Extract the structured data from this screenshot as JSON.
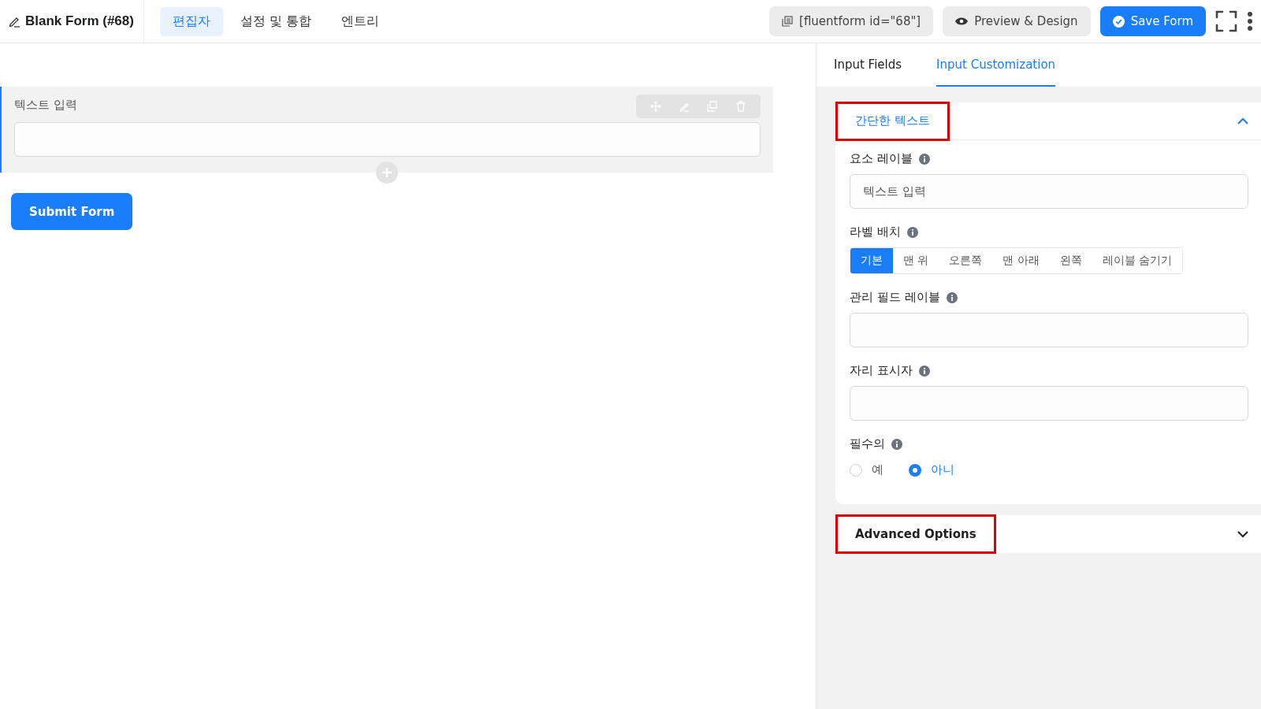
{
  "header": {
    "form_title": "Blank Form (#68)",
    "tabs": [
      {
        "label": "편집자",
        "selected": true
      },
      {
        "label": "설정 및 통합",
        "selected": false
      },
      {
        "label": "엔트리",
        "selected": false
      }
    ],
    "shortcode": "[fluentform id=\"68\"]",
    "preview_button": "Preview & Design",
    "save_button": "Save Form"
  },
  "canvas": {
    "field": {
      "label": "텍스트 입력"
    },
    "submit_button": "Submit Form"
  },
  "sidebar": {
    "tabs": [
      {
        "label": "Input Fields",
        "selected": false
      },
      {
        "label": "Input Customization",
        "selected": true
      }
    ],
    "sections": [
      {
        "title": "간단한 텍스트",
        "expanded": true,
        "highlighted": true,
        "settings": [
          {
            "kind": "text",
            "label": "요소 레이블",
            "value": "텍스트 입력"
          },
          {
            "kind": "segmented",
            "label": "라벨 배치",
            "options": [
              {
                "label": "기본",
                "selected": true
              },
              {
                "label": "맨 위",
                "selected": false
              },
              {
                "label": "오른쪽",
                "selected": false
              },
              {
                "label": "맨 아래",
                "selected": false
              },
              {
                "label": "왼쪽",
                "selected": false
              },
              {
                "label": "레이블 숨기기",
                "selected": false
              }
            ]
          },
          {
            "kind": "text",
            "label": "관리 필드 레이블"
          },
          {
            "kind": "text",
            "label": "자리 표시자"
          },
          {
            "kind": "radio",
            "label": "필수의",
            "options": [
              {
                "label": "예",
                "selected": false
              },
              {
                "label": "아니",
                "selected": true
              }
            ]
          }
        ]
      },
      {
        "title": "Advanced Options",
        "expanded": false,
        "highlighted": true
      }
    ]
  }
}
